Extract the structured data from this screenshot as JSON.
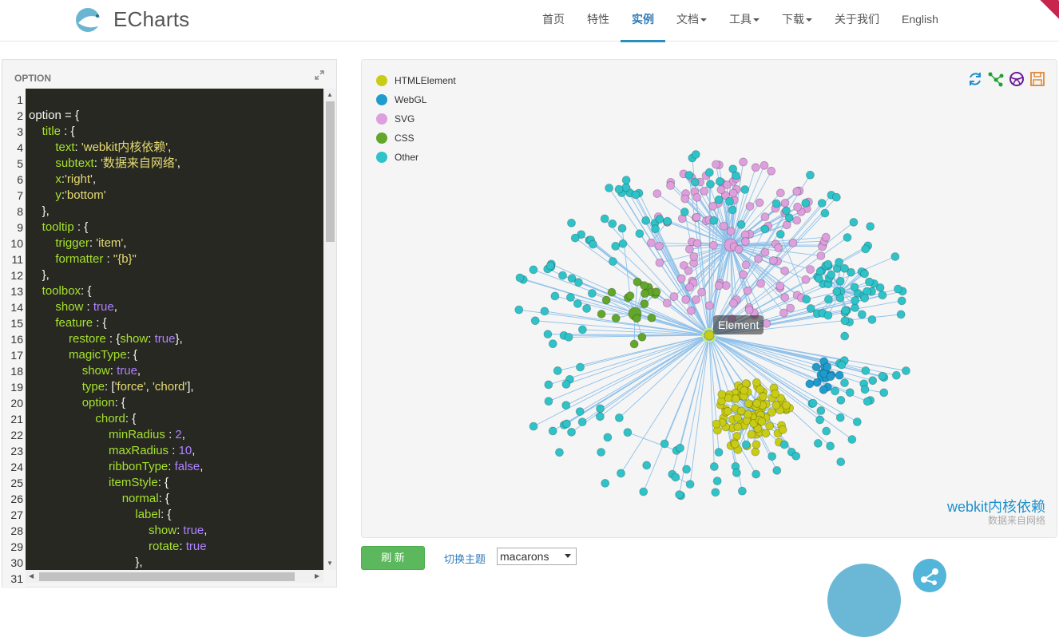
{
  "brand": {
    "name": "ECharts"
  },
  "nav": {
    "items": [
      "首页",
      "特性",
      "实例",
      "文档",
      "工具",
      "下载",
      "关于我们",
      "English"
    ],
    "active": "实例",
    "dropdowns": [
      "文档",
      "工具",
      "下载"
    ]
  },
  "code_panel": {
    "title": "OPTION",
    "line_numbers": [
      1,
      2,
      3,
      4,
      5,
      6,
      7,
      8,
      9,
      10,
      11,
      12,
      13,
      14,
      15,
      16,
      17,
      18,
      19,
      20,
      21,
      22,
      23,
      24,
      25,
      26,
      27,
      28,
      29,
      30,
      31
    ],
    "lines": [
      "",
      "option = {",
      "    title : {",
      "        text: 'webkit内核依赖',",
      "        subtext: '数据来自网络',",
      "        x:'right',",
      "        y:'bottom'",
      "    },",
      "    tooltip : {",
      "        trigger: 'item',",
      "        formatter : \"{b}\"",
      "    },",
      "    toolbox: {",
      "        show : true,",
      "        feature : {",
      "            restore : {show: true},",
      "            magicType: {",
      "                show: true,",
      "                type: ['force', 'chord'],",
      "                option: {",
      "                    chord: {",
      "                        minRadius : 2,",
      "                        maxRadius : 10,",
      "                        ribbonType: false,",
      "                        itemStyle: {",
      "                            normal: {",
      "                                label: {",
      "                                    show: true,",
      "                                    rotate: true",
      "                                },",
      ""
    ]
  },
  "chart": {
    "legend": [
      {
        "name": "HTMLElement",
        "color": "#c9cc14"
      },
      {
        "name": "WebGL",
        "color": "#1e9cce"
      },
      {
        "name": "SVG",
        "color": "#dd9fdd"
      },
      {
        "name": "CSS",
        "color": "#62a62a"
      },
      {
        "name": "Other",
        "color": "#2ec3c9"
      }
    ],
    "toolbox_icons": [
      "restore-icon",
      "force-layout-icon",
      "chord-layout-icon",
      "save-icon"
    ],
    "tooltip": "Element",
    "title": "webkit内核依赖",
    "subtitle": "数据来自网络"
  },
  "chart_data": {
    "type": "graph",
    "layout": "force",
    "categories": [
      "HTMLElement",
      "WebGL",
      "SVG",
      "CSS",
      "Other"
    ],
    "highlighted_node": "Element",
    "title": "webkit内核依赖",
    "subtitle": "数据来自网络"
  },
  "controls": {
    "refresh_label": "刷 新",
    "theme_label": "切换主题",
    "theme_value": "macarons"
  }
}
